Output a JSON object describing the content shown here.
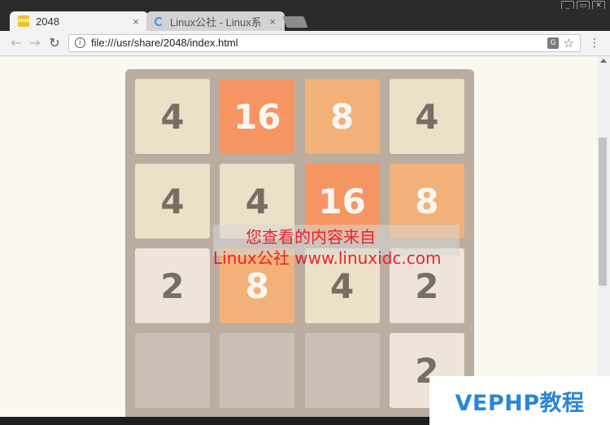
{
  "window": {
    "controls": [
      "_",
      "▭",
      "✕"
    ]
  },
  "tabs": [
    {
      "title": "2048",
      "favicon_text": "2048",
      "close": "×"
    },
    {
      "title": "Linux公社 - Linux系",
      "close": "×"
    }
  ],
  "toolbar": {
    "back": "←",
    "forward": "→",
    "reload": "↻",
    "url": "file:///usr/share/2048/index.html",
    "menu": "⋮",
    "star": "☆",
    "translate": "G"
  },
  "game": {
    "grid": [
      [
        4,
        16,
        8,
        4
      ],
      [
        4,
        4,
        16,
        8
      ],
      [
        2,
        8,
        4,
        2
      ],
      [
        null,
        null,
        null,
        2
      ]
    ],
    "colors": {
      "board": "#bbada0",
      "tile_2": "#eee4da",
      "tile_4": "#ede0c8",
      "tile_8": "#f2b179",
      "tile_16": "#f59563",
      "dark_text": "#776e65",
      "light_text": "#f9f6f2"
    }
  },
  "watermark": {
    "line1": "您查看的内容来自",
    "line2": "Linux公社 www.linuxidc.com"
  },
  "brand": {
    "text": "VEPHP教程"
  }
}
